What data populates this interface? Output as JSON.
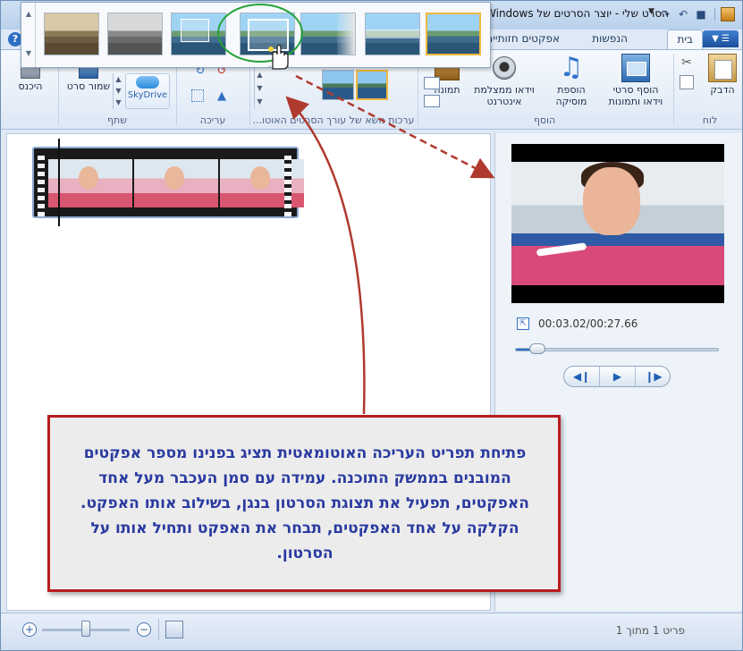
{
  "window": {
    "title": "הסרט שלי - יוצר הסרטים של Windows"
  },
  "tabs": [
    {
      "label": "בית"
    },
    {
      "label": "הנפשות"
    },
    {
      "label": "אפקטים חזותיים"
    }
  ],
  "ribbon": {
    "clipboard": {
      "paste_label": "הדבק",
      "group_label": "לוח"
    },
    "add": {
      "add_media_label": "הוסף סרטי וידאו ותמונות",
      "add_music_label": "הוספת מוסיקה",
      "webcam_label": "וידאו ממצלמת אינטרנט",
      "snapshot_label": "תמונה",
      "group_label": "הוסף"
    },
    "autotheme": {
      "group_label": "ערכות נושא של עורך הסרטים האוטו..."
    },
    "editing": {
      "group_label": "עריכה"
    },
    "share": {
      "skydrive_label": "SkyDrive",
      "save_movie_label": "שמור סרט",
      "group_label": "שתף"
    },
    "sign_in_label": "היכנס"
  },
  "gallery": {
    "items": [
      {
        "name": "Sepia"
      },
      {
        "name": "Black and white"
      },
      {
        "name": "Split"
      },
      {
        "name": "Pan and zoom"
      },
      {
        "name": "Page curl"
      },
      {
        "name": "Wipe"
      },
      {
        "name": "Contemporary"
      }
    ],
    "dots": "......"
  },
  "preview": {
    "time": "00:03.02/00:27.66",
    "seek_progress": 0.11
  },
  "statusbar": {
    "item_count": "פריט 1 מתוך 1",
    "zoom_level": 0.5
  },
  "callout": {
    "text": "פתיחת תפריט העריכה האוטומאטית תציג בפנינו מספר אפקטים המובנים בממשק התוכנה. עמידה עם סמן העכבר מעל אחד האפקטים, תפעיל את תצוגת הסרטון בנגן, בשילוב אותו האפקט. הקלקה על אחד האפקטים, תבחר את האפקט ותחיל אותו על הסרטון."
  },
  "colors": {
    "callout_border": "#b71c1c",
    "callout_text": "#2a3aa0",
    "highlight_circle": "#25a33a",
    "arrow": "#b03a2e"
  }
}
